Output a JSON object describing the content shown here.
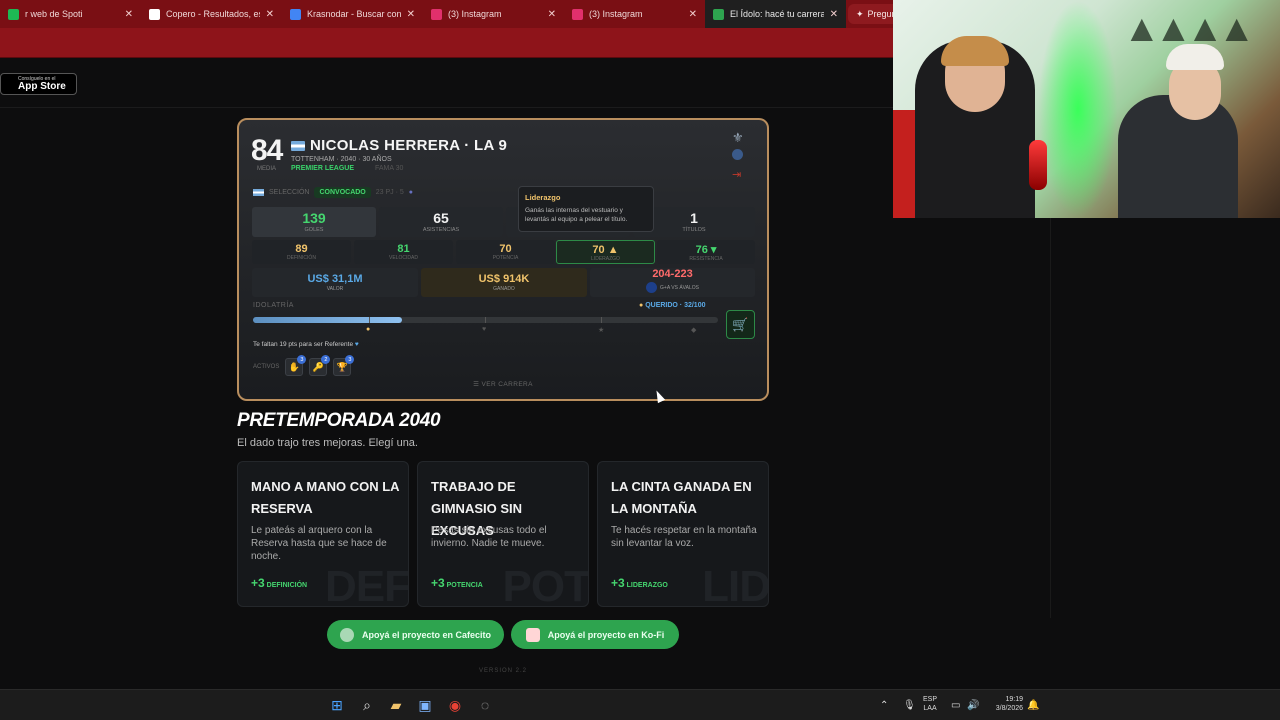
{
  "browser": {
    "tabs": [
      {
        "title": "r web de Spoti",
        "fav": "spotify",
        "color": "#1db954"
      },
      {
        "title": "Copero - Resultados, estad",
        "fav": "copero",
        "color": "#ffffff"
      },
      {
        "title": "Krasnodar - Buscar con Go",
        "fav": "google",
        "color": "#4285f4"
      },
      {
        "title": "(3) Instagram",
        "fav": "instagram",
        "color": "#e1306c"
      },
      {
        "title": "(3) Instagram",
        "fav": "instagram",
        "color": "#e1306c"
      },
      {
        "title": "El Ídolo: hacé tu carrera en",
        "fav": "idolo",
        "color": "#2ea44f"
      }
    ],
    "new_tab": "+",
    "right_tab": "Pregun"
  },
  "app_store": {
    "small": "Consíguelo en el",
    "big": "App Store"
  },
  "player": {
    "rating": "84",
    "rating_label": "MEDIA",
    "name": "NICOLAS HERRERA · LA 9",
    "sub": "TOTTENHAM · 2040 · 30 AÑOS",
    "league": "PREMIER LEAGUE",
    "fama": "FAMA 30",
    "seleccion_label": "SELECCIÓN",
    "convocado": "CONVOCADO",
    "sel_stats": "23 PJ · 5",
    "stats": [
      {
        "value": "139",
        "label": "GOLES",
        "color": "#45d66f"
      },
      {
        "value": "65",
        "label": "ASISTENCIAS",
        "color": "#f2f2f2"
      },
      {
        "value": "1",
        "label": "TÍTULOS",
        "color": "#f2f2f2"
      }
    ],
    "attrs": [
      {
        "value": "89",
        "label": "DEFINICIÓN",
        "color": "#f0c36b"
      },
      {
        "value": "81",
        "label": "VELOCIDAD",
        "color": "#45d66f"
      },
      {
        "value": "70",
        "label": "POTENCIA",
        "color": "#f0c36b"
      },
      {
        "value": "70 ▲",
        "label": "LIDERAZGO",
        "color": "#f0c36b"
      },
      {
        "value": "76 ▾",
        "label": "RESISTENCIA",
        "color": "#45d66f"
      }
    ],
    "money": [
      {
        "value": "US$ 31,1M",
        "label": "VALOR",
        "color": "#5aa9e6"
      },
      {
        "value": "US$ 914K",
        "label": "GANADO",
        "color": "#f0c36b"
      }
    ],
    "rival": {
      "value": "204-223",
      "label": "G+A VS ÁVALOS",
      "color": "#ff6b6b"
    },
    "tooltip": {
      "title": "Liderazgo",
      "desc": "Ganás las internas del vestuario y levantás al equipo a pelear el título."
    },
    "idolatria_label": "IDOLATRÍA",
    "idolatria_status": "QUERIDO · 32/100",
    "idolatria_value": 32,
    "faltan": "Te faltan 19 pts para ser Referente",
    "activos_label": "ACTIVOS",
    "activos": [
      {
        "icon": "✋",
        "count": "3"
      },
      {
        "icon": "🔑",
        "count": "2"
      },
      {
        "icon": "🏆",
        "count": "3"
      }
    ],
    "ver_carrera": "☰  VER CARRERA"
  },
  "pretemporada": {
    "title": "PRETEMPORADA 2040",
    "subtitle": "El dado trajo tres mejoras. Elegí una.",
    "choices": [
      {
        "title": "MANO A MANO CON LA RESERVA",
        "desc": "Le pateás al arquero con la Reserva hasta que se hace de noche.",
        "bonus": "+3",
        "attr": "DEFINICIÓN",
        "wm": "DEF"
      },
      {
        "title": "TRABAJO DE GIMNASIO SIN EXCUSAS",
        "desc": "Pesas sin excusas todo el invierno. Nadie te mueve.",
        "bonus": "+3",
        "attr": "POTENCIA",
        "wm": "POT"
      },
      {
        "title": "LA CINTA GANADA EN LA MONTAÑA",
        "desc": "Te hacés respetar en la montaña sin levantar la voz.",
        "bonus": "+3",
        "attr": "LIDERAZGO",
        "wm": "LID"
      }
    ]
  },
  "support": {
    "cafecito": "Apoyá el proyecto en Cafecito",
    "kofi": "Apoyá el proyecto en Ko-Fi"
  },
  "version": "VERSION 2.2",
  "taskbar": {
    "lang_top": "ESP",
    "lang_bottom": "LAA",
    "time": "19:19",
    "date": "3/8/2026"
  }
}
